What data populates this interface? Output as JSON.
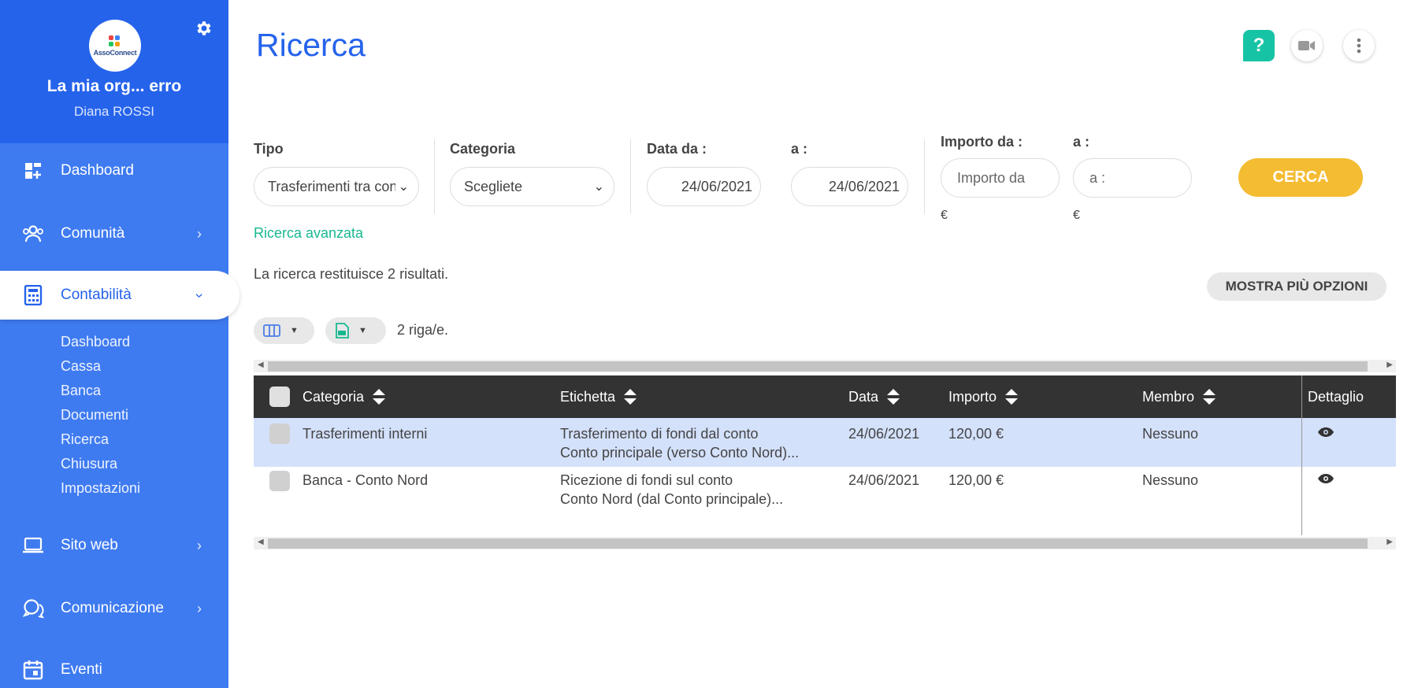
{
  "sidebar": {
    "logo_text": "AssoConnect",
    "org_name": "La mia org... erro",
    "user_name": "Diana ROSSI",
    "nav": [
      {
        "label": "Dashboard",
        "icon": "dashboard-icon"
      },
      {
        "label": "Comunità",
        "icon": "community-icon"
      },
      {
        "label": "Contabilità",
        "icon": "calculator-icon"
      },
      {
        "label": "Sito web",
        "icon": "laptop-icon"
      },
      {
        "label": "Comunicazione",
        "icon": "chat-icon"
      },
      {
        "label": "Eventi",
        "icon": "calendar-icon"
      }
    ],
    "chevron": "›",
    "subnav": [
      "Dashboard",
      "Cassa",
      "Banca",
      "Documenti",
      "Ricerca",
      "Chiusura",
      "Impostazioni"
    ]
  },
  "page": {
    "title": "Ricerca",
    "help_label": "?"
  },
  "filters": {
    "tipo_label": "Tipo",
    "tipo_value": "Trasferimenti tra conti",
    "categoria_label": "Categoria",
    "categoria_value": "Scegliete",
    "data_da_label": "Data da :",
    "data_a_label": "a :",
    "data_da_value": "24/06/2021",
    "data_a_value": "24/06/2021",
    "importo_da_label": "Importo da :",
    "importo_a_label": "a :",
    "importo_da_placeholder": "Importo da",
    "importo_a_placeholder": "a :",
    "currency": "€",
    "chevron": "⌄",
    "search_button": "CERCA",
    "advanced_link": "Ricerca avanzata"
  },
  "results": {
    "summary": "La ricerca restituisce 2 risultati.",
    "more_options": "MOSTRA PIÙ OPZIONI",
    "rows_count": "2 riga/e.",
    "caret": "▼"
  },
  "table": {
    "columns": [
      "Categoria",
      "Etichetta",
      "Data",
      "Importo",
      "Membro",
      "Dettaglio"
    ],
    "rows": [
      {
        "categoria": "Trasferimenti interni",
        "etichetta_1": "Trasferimento di fondi dal conto",
        "etichetta_2": "Conto principale (verso Conto Nord)...",
        "data": "24/06/2021",
        "importo": "120,00 €",
        "membro": "Nessuno"
      },
      {
        "categoria": "Banca - Conto Nord",
        "etichetta_1": "Ricezione di fondi sul conto",
        "etichetta_2": "Conto Nord (dal Conto principale)...",
        "data": "24/06/2021",
        "importo": "120,00 €",
        "membro": "Nessuno"
      }
    ],
    "scroll_left": "◀",
    "scroll_right": "▶"
  },
  "colors": {
    "sidebar": "#3f7bf0",
    "sidebar_header": "#2563eb",
    "accent": "#2563eb",
    "cta": "#f4bc32",
    "link": "#17b890",
    "selected_row": "#d4e1fb"
  }
}
